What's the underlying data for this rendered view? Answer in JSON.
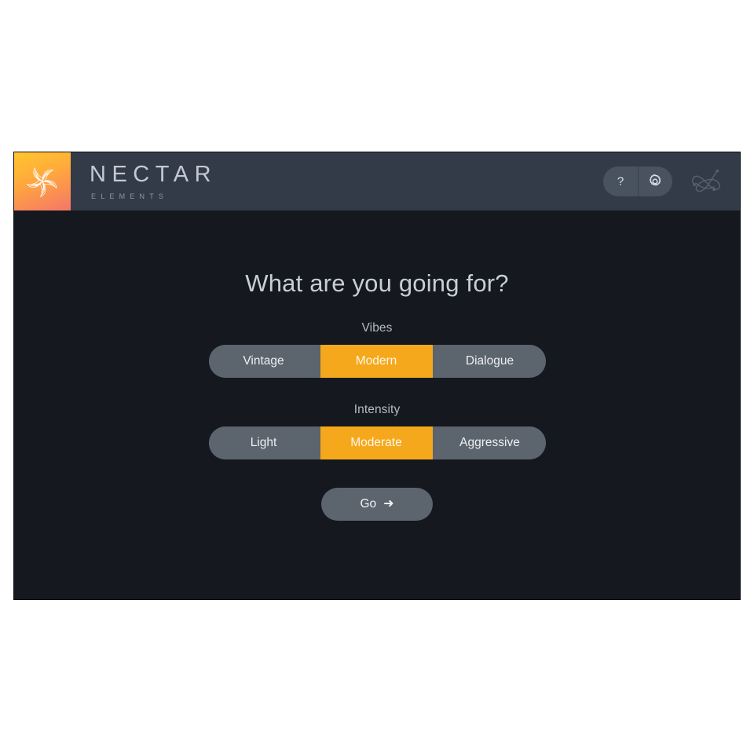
{
  "app": {
    "brand_name": "NECTAR",
    "brand_sub": "ELEMENTS",
    "logo_icon": "nectar-pinwheel-logo"
  },
  "header": {
    "help_icon": "question-mark-icon",
    "help_glyph": "?",
    "settings_icon": "gear-icon",
    "decoration_icon": "scribble-waveform-mark"
  },
  "main": {
    "title": "What are you going for?",
    "groups": [
      {
        "label": "Vibes",
        "options": [
          "Vintage",
          "Modern",
          "Dialogue"
        ],
        "selected": "Modern"
      },
      {
        "label": "Intensity",
        "options": [
          "Light",
          "Moderate",
          "Aggressive"
        ],
        "selected": "Moderate"
      }
    ],
    "go_label": "Go",
    "go_arrow": "➜"
  },
  "colors": {
    "accent_orange": "#f6a81c",
    "header_bar": "#333b48",
    "panel_bg": "#15181e",
    "segment_gray": "#5c646e",
    "text_light": "#c9ced6"
  }
}
